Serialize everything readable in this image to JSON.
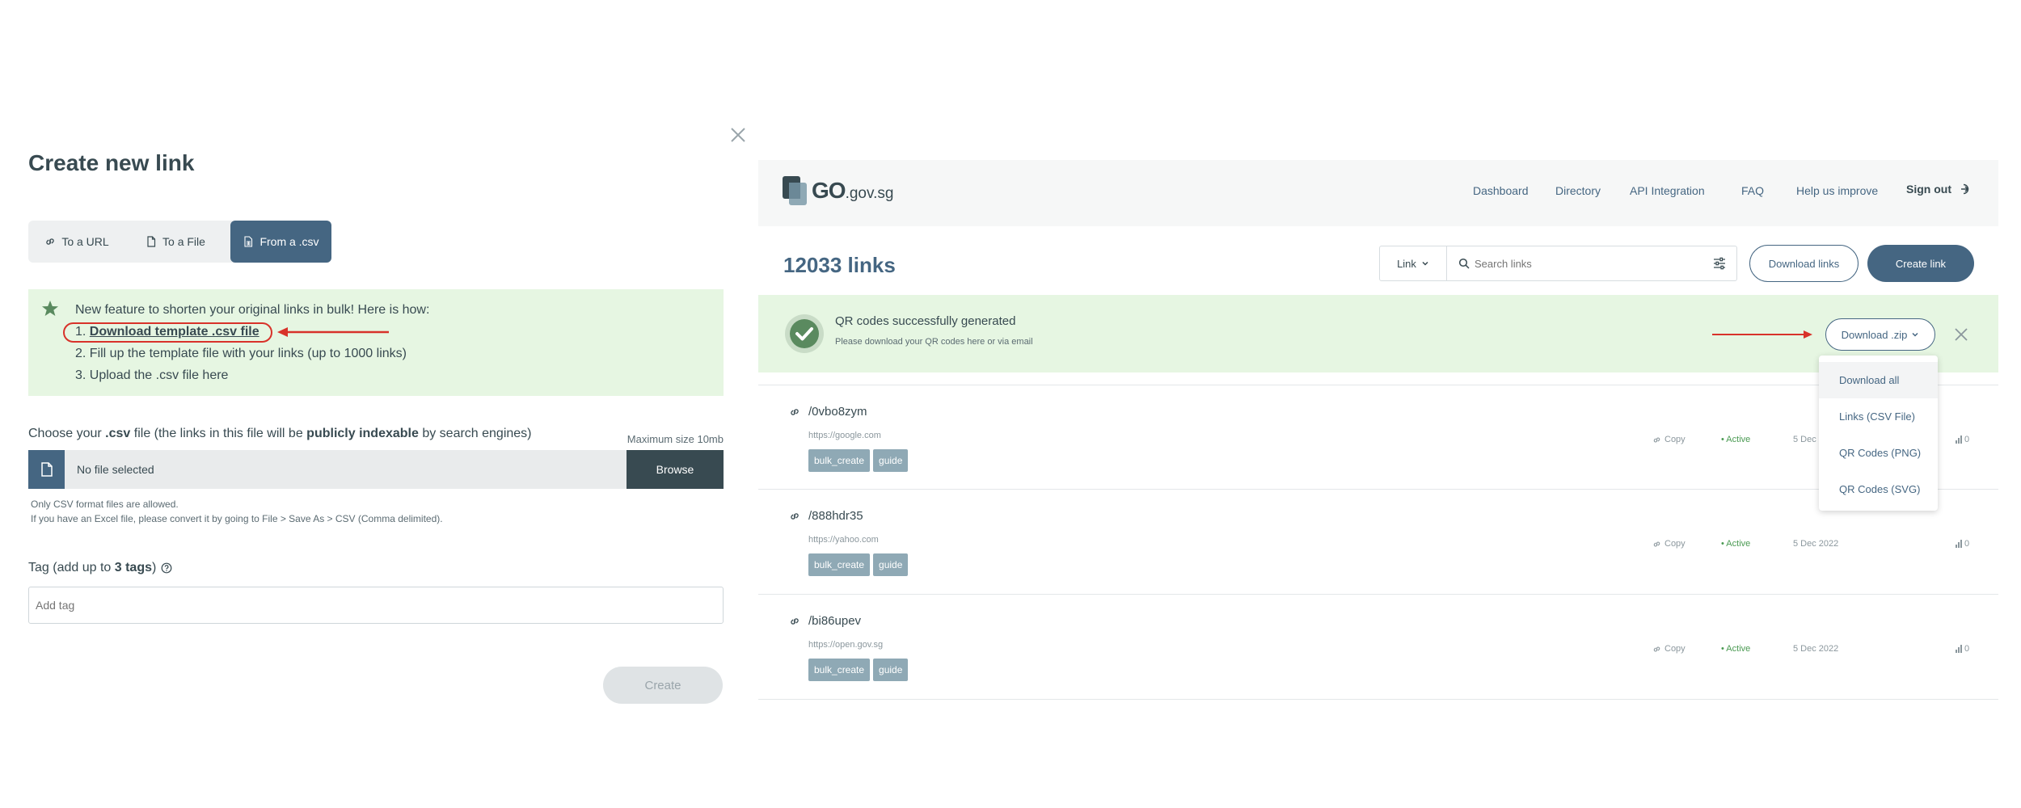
{
  "modal": {
    "title": "Create new link",
    "tabs": [
      {
        "label": "To a URL",
        "icon": "link-icon"
      },
      {
        "label": "To a File",
        "icon": "file-icon"
      },
      {
        "label": "From a .csv",
        "icon": "csv-icon",
        "selected": true
      }
    ],
    "info": {
      "intro": "New feature to shorten your original links in bulk! Here is how:",
      "step1_num": "1.",
      "step1_link": "Download template .csv file",
      "step2": "2. Fill up the template file with your links (up to 1000 links)",
      "step3": "3. Upload the .csv file here"
    },
    "csv_label": {
      "part1": "Choose your ",
      "csv": ".csv",
      "part2": " file (the links in this file will be ",
      "indexable": "publicly indexable",
      "part3": " by search engines)"
    },
    "max_size": "Maximum size 10mb",
    "file_status": "No file selected",
    "browse_label": "Browse",
    "help_line1": "Only CSV format files are allowed.",
    "help_line2": "If you have an Excel file, please convert it by going to File > Save As > CSV (Comma delimited).",
    "tag_label_prefix": "Tag (add up to ",
    "tag_label_bold": "3 tags",
    "tag_label_suffix": ")",
    "tag_placeholder": "Add tag",
    "create_label": "Create",
    "colors": {
      "accent": "#456682",
      "info_bg": "#e6f6e2",
      "highlight": "#d8322a"
    }
  },
  "app": {
    "logo": {
      "go": "GO",
      "domain": ".gov.sg"
    },
    "nav": [
      "Dashboard",
      "Directory",
      "API Integration",
      "FAQ",
      "Help us improve"
    ],
    "sign_out": "Sign out",
    "links_count": "12033 links",
    "search": {
      "type": "Link",
      "placeholder": "Search links"
    },
    "download_links_label": "Download links",
    "create_link_label": "Create link",
    "banner": {
      "title": "QR codes successfully generated",
      "subtitle": "Please download your QR codes here or via email",
      "button_label": "Download .zip"
    },
    "dropdown": [
      "Download all",
      "Links (CSV File)",
      "QR Codes (PNG)",
      "QR Codes (SVG)"
    ],
    "rows": [
      {
        "short": "/0vbo8zym",
        "long": "https://google.com",
        "tags": [
          "bulk_create",
          "guide"
        ],
        "copy": "Copy",
        "status": "• Active",
        "date": "5 Dec",
        "clicks": "0"
      },
      {
        "short": "/888hdr35",
        "long": "https://yahoo.com",
        "tags": [
          "bulk_create",
          "guide"
        ],
        "copy": "Copy",
        "status": "• Active",
        "date": "5 Dec 2022",
        "clicks": "0"
      },
      {
        "short": "/bi86upev",
        "long": "https://open.gov.sg",
        "tags": [
          "bulk_create",
          "guide"
        ],
        "copy": "Copy",
        "status": "• Active",
        "date": "5 Dec 2022",
        "clicks": "0"
      }
    ]
  }
}
